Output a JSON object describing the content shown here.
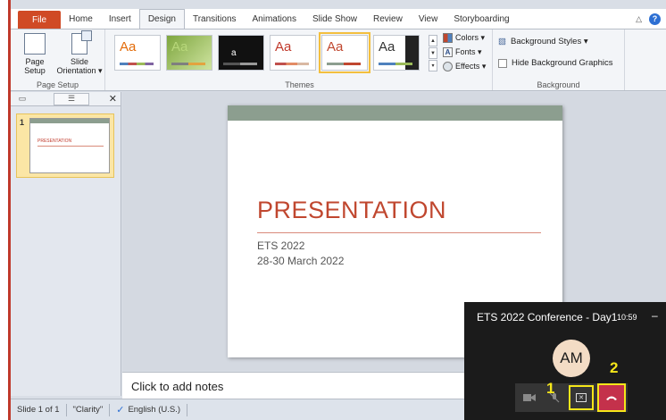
{
  "ribbon": {
    "tabs": [
      "File",
      "Home",
      "Insert",
      "Design",
      "Transitions",
      "Animations",
      "Slide Show",
      "Review",
      "View",
      "Storyboarding"
    ],
    "active_tab": "Design",
    "page_setup": {
      "page_setup_label": "Page Setup",
      "slide_orientation_label": "Slide Orientation ▾",
      "group_label": "Page Setup"
    },
    "themes": {
      "group_label": "Themes",
      "variant_options": {
        "colors": "Colors ▾",
        "fonts": "Fonts ▾",
        "effects": "Effects ▾"
      }
    },
    "background": {
      "group_label": "Background",
      "styles": "Background Styles ▾",
      "hide_graphics": "Hide Background Graphics"
    }
  },
  "thumbnail": {
    "number": "1",
    "title": "PRESENTATION"
  },
  "slide": {
    "title": "PRESENTATION",
    "subtitle_line1": "ETS 2022",
    "subtitle_line2": "28-30 March 2022"
  },
  "notes": {
    "placeholder": "Click to add notes"
  },
  "status": {
    "slide_count": "Slide 1 of 1",
    "theme": "\"Clarity\"",
    "language": "English (U.S.)"
  },
  "call": {
    "title": "ETS 2022 Conference - Day1",
    "time": "10:59",
    "minimize": "–",
    "avatar_initials": "AM",
    "markers": [
      "1",
      "2"
    ]
  },
  "colors": {
    "accent_red": "#c0472f",
    "file_tab": "#d04a25",
    "highlight_yellow": "#f5e61a",
    "end_call": "#c4314b"
  }
}
